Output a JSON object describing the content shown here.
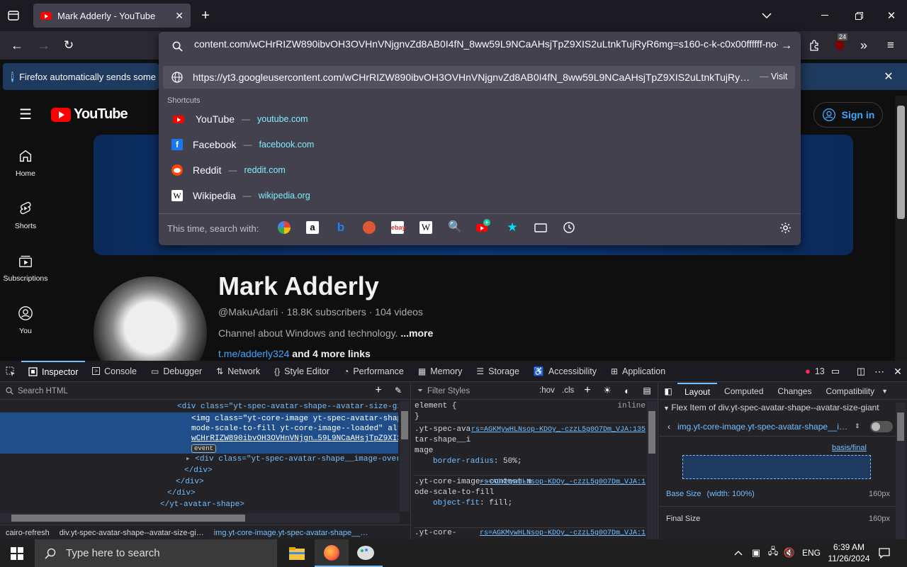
{
  "browser": {
    "tab_title": "Mark Adderly - YouTube",
    "url_text": "content.com/wCHrRIZW890ibvOH3OVHnVNjgnvZd8AB0I4fN_8ww59L9NCaAHsjTpZ9XIS2uLtnkTujRyR6mg=s160-c-k-c0x00ffffff-no-rj",
    "suggestion_url": "https://yt3.googleusercontent.com/wCHrRIZW890ibvOH3OVHnVNjgnvZd8AB0I4fN_8ww59L9NCaAHsjTpZ9XIS2uLtnkTujRyR6mg",
    "suggestion_action": "Visit",
    "suggestion_sep": "—",
    "shortcuts_header": "Shortcuts",
    "shortcuts": [
      {
        "name": "YouTube",
        "url": "youtube.com",
        "icon": "youtube-icon"
      },
      {
        "name": "Facebook",
        "url": "facebook.com",
        "icon": "facebook-icon"
      },
      {
        "name": "Reddit",
        "url": "reddit.com",
        "icon": "reddit-icon"
      },
      {
        "name": "Wikipedia",
        "url": "wikipedia.org",
        "icon": "wikipedia-icon"
      }
    ],
    "search_with_label": "This time, search with:",
    "extensions_badge": "24",
    "infobar_text": "Firefox automatically sends some d"
  },
  "youtube": {
    "logo_text": "YouTube",
    "sign_in": "Sign in",
    "nav": [
      {
        "label": "Home",
        "icon": "home-icon"
      },
      {
        "label": "Shorts",
        "icon": "shorts-icon"
      },
      {
        "label": "Subscriptions",
        "icon": "subscriptions-icon"
      },
      {
        "label": "You",
        "icon": "you-icon"
      }
    ],
    "channel_name": "Mark Adderly",
    "channel_meta": "@MakuAdarii · 18.8K subscribers · 104 videos",
    "description": "Channel about Windows and technology.",
    "more": "...more",
    "link": "t.me/adderly324",
    "more_links": "and 4 more links"
  },
  "devtools": {
    "tabs": [
      "Inspector",
      "Console",
      "Debugger",
      "Network",
      "Style Editor",
      "Performance",
      "Memory",
      "Storage",
      "Accessibility",
      "Application"
    ],
    "error_count": "13",
    "search_placeholder": "Search HTML",
    "filter_placeholder": "Filter Styles",
    "hov": ":hov",
    "cls": ".cls",
    "html_lines": [
      "<div class=\"yt-spec-avatar-shape--avatar-size-giant",
      "<img class=\"yt-core-image yt-spec-avatar-shape__i",
      "mode-scale-to-fill yt-core-image--loaded\" alt=\"\"",
      "wCHrRIZW890ibvOH3OVHnVNjgn…59L9NCaAHsjTpZ9XIS2uLt",
      "event",
      "<div class=\"yt-spec-avatar-shape__image-overlays",
      "</div>",
      "</div>",
      "</div>",
      "</yt-avatar-shape>"
    ],
    "breadcrumbs": [
      "cairo-refresh",
      "div.yt-spec-avatar-shape--avatar-size-gi…",
      "img.yt-core-image.yt-spec-avatar-shape__…"
    ],
    "rules": [
      {
        "selector": "element",
        "open": "{",
        "source": "inline",
        "close": "}"
      },
      {
        "selector": ".yt-spec-avatar-shape__image",
        "source": "rs=AGKMywHLNsop-KDOy_-czzL5g0O7Dm_VJA:135",
        "decl_prop": "border-radius",
        "decl_val": "50%;"
      },
      {
        "selector": ".yt-core-image--content-mode-scale-to-fill",
        "source": "rs=AGKMywHLNsop-KDOy_-czzL5g0O7Dm_VJA:1",
        "decl_prop": "object-fit",
        "decl_val": "fill;"
      },
      {
        "selector": ".yt-core-",
        "source": "rs=AGKMywHLNsop-KDOy_-czzL5g0O7Dm_VJA:1"
      }
    ],
    "layout_tabs": [
      "Layout",
      "Computed",
      "Changes",
      "Compatibility"
    ],
    "flex_item_header": "Flex Item of div.yt-spec-avatar-shape--avatar-size-giant",
    "flex_item_select": "img.yt-core-image.yt-spec-avatar-shape__i…",
    "basis_label": "basis/final",
    "base_size_label": "Base Size",
    "base_size_note": "(width: 100%)",
    "base_size_val": "160px",
    "final_size_label": "Final Size",
    "final_size_val": "160px"
  },
  "taskbar": {
    "search_placeholder": "Type here to search",
    "lang": "ENG",
    "time": "6:39 AM",
    "date": "11/26/2024"
  },
  "colors": {
    "accent": "#75bfff",
    "youtube_red": "#ff0000",
    "link": "#3ea6ff"
  }
}
